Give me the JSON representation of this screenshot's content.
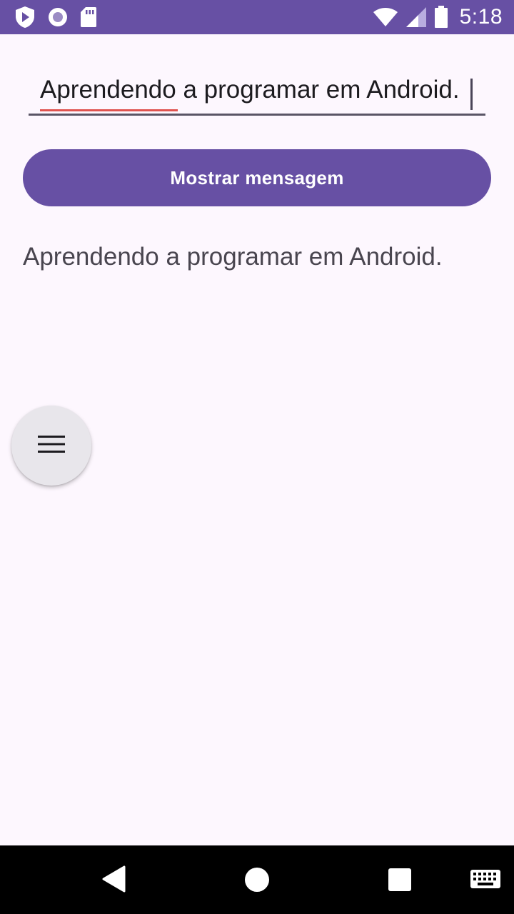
{
  "status_bar": {
    "time": "5:18",
    "left_icons": [
      "shield-play-icon",
      "radio-circle-icon",
      "sd-card-icon"
    ],
    "right_icons": [
      "wifi-icon",
      "cell-signal-icon",
      "battery-icon"
    ]
  },
  "input": {
    "value": "Aprendendo a programar em Android.",
    "misspelled_word": "Aprendendo"
  },
  "button": {
    "label": "Mostrar mensagem"
  },
  "message": {
    "text": "Aprendendo a programar em Android."
  },
  "fab": {
    "icon": "menu-icon"
  },
  "nav_bar": {
    "icons": [
      "back-icon",
      "home-icon",
      "recents-icon",
      "keyboard-icon"
    ]
  },
  "colors": {
    "primary": "#6750a4",
    "background": "#fdf7fe",
    "on_primary": "#ffffff",
    "text_secondary": "#49454f",
    "spell_error": "#e0534f",
    "fab_surface": "#e8e6eb"
  }
}
